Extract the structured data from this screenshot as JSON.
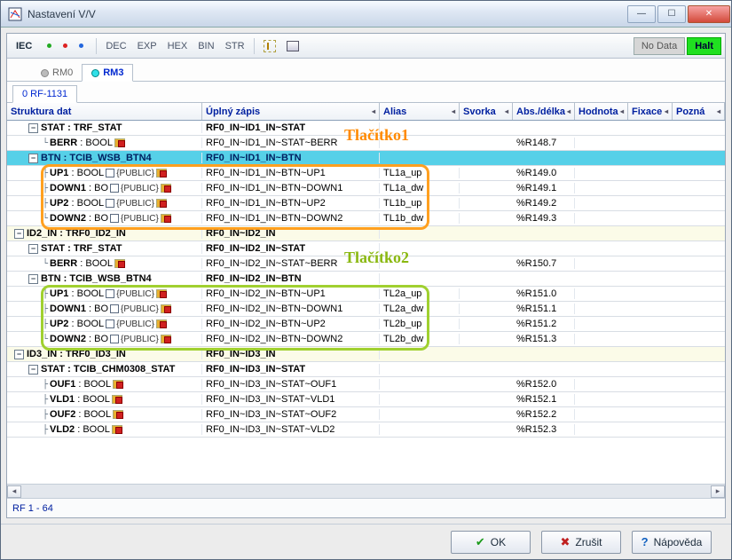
{
  "window": {
    "title": "Nastavení V/V"
  },
  "toolbar": {
    "iec": "IEC",
    "fmt": [
      "DEC",
      "EXP",
      "HEX",
      "BIN",
      "STR"
    ],
    "nodata": "No Data",
    "halt": "Halt"
  },
  "rmtabs": {
    "rm0": "RM0",
    "rm3": "RM3"
  },
  "nodetab": "0 RF-1131",
  "columns": {
    "struct": "Struktura dat",
    "full": "Úplný zápis",
    "alias": "Alias",
    "svorka": "Svorka",
    "abs": "Abs./délka",
    "hodnota": "Hodnota",
    "fix": "Fixace",
    "pozn": "Pozná"
  },
  "rows": [
    {
      "indent": 1,
      "glyph": "-",
      "name": "STAT",
      "type": ": TRF_STAT",
      "full": "RF0_IN~ID1_IN~STAT",
      "bold": true,
      "icon": false
    },
    {
      "indent": 2,
      "glyph": "L",
      "name": "BERR",
      "type": ": BOOL",
      "full": "RF0_IN~ID1_IN~STAT~BERR",
      "abs": "%R148.7",
      "icon": true
    },
    {
      "indent": 1,
      "glyph": "-",
      "name": "BTN",
      "type": ": TCIB_WSB_BTN4",
      "full": "RF0_IN~ID1_IN~BTN",
      "bold": true,
      "hl": "cyan",
      "icon": false
    },
    {
      "indent": 2,
      "glyph": "T",
      "name": "UP1",
      "type": ": BOOL",
      "pub": true,
      "full": "RF0_IN~ID1_IN~BTN~UP1",
      "alias": "TL1a_up",
      "abs": "%R149.0",
      "icon": true
    },
    {
      "indent": 2,
      "glyph": "T",
      "name": "DOWN1",
      "type": ": BO",
      "pub": true,
      "full": "RF0_IN~ID1_IN~BTN~DOWN1",
      "alias": "TL1a_dw",
      "abs": "%R149.1",
      "icon": true
    },
    {
      "indent": 2,
      "glyph": "T",
      "name": "UP2",
      "type": ": BOOL",
      "pub": true,
      "full": "RF0_IN~ID1_IN~BTN~UP2",
      "alias": "TL1b_up",
      "abs": "%R149.2",
      "icon": true
    },
    {
      "indent": 2,
      "glyph": "L",
      "name": "DOWN2",
      "type": ": BO",
      "pub": true,
      "full": "RF0_IN~ID1_IN~BTN~DOWN2",
      "alias": "TL1b_dw",
      "abs": "%R149.3",
      "icon": true
    },
    {
      "indent": 0,
      "glyph": "-",
      "name": "ID2_IN",
      "type": ": TRF0_ID2_IN",
      "full": "RF0_IN~ID2_IN",
      "bold": true,
      "hl": "pale",
      "icon": false
    },
    {
      "indent": 1,
      "glyph": "-",
      "name": "STAT",
      "type": ": TRF_STAT",
      "full": "RF0_IN~ID2_IN~STAT",
      "bold": true,
      "icon": false
    },
    {
      "indent": 2,
      "glyph": "L",
      "name": "BERR",
      "type": ": BOOL",
      "full": "RF0_IN~ID2_IN~STAT~BERR",
      "abs": "%R150.7",
      "icon": true
    },
    {
      "indent": 1,
      "glyph": "-",
      "name": "BTN",
      "type": ": TCIB_WSB_BTN4",
      "full": "RF0_IN~ID2_IN~BTN",
      "bold": true,
      "icon": false
    },
    {
      "indent": 2,
      "glyph": "T",
      "name": "UP1",
      "type": ": BOOL",
      "pub": true,
      "full": "RF0_IN~ID2_IN~BTN~UP1",
      "alias": "TL2a_up",
      "abs": "%R151.0",
      "icon": true
    },
    {
      "indent": 2,
      "glyph": "T",
      "name": "DOWN1",
      "type": ": BO",
      "pub": true,
      "full": "RF0_IN~ID2_IN~BTN~DOWN1",
      "alias": "TL2a_dw",
      "abs": "%R151.1",
      "icon": true
    },
    {
      "indent": 2,
      "glyph": "T",
      "name": "UP2",
      "type": ": BOOL",
      "pub": true,
      "full": "RF0_IN~ID2_IN~BTN~UP2",
      "alias": "TL2b_up",
      "abs": "%R151.2",
      "icon": true
    },
    {
      "indent": 2,
      "glyph": "L",
      "name": "DOWN2",
      "type": ": BO",
      "pub": true,
      "full": "RF0_IN~ID2_IN~BTN~DOWN2",
      "alias": "TL2b_dw",
      "abs": "%R151.3",
      "icon": true
    },
    {
      "indent": 0,
      "glyph": "-",
      "name": "ID3_IN",
      "type": ": TRF0_ID3_IN",
      "full": "RF0_IN~ID3_IN",
      "bold": true,
      "hl": "pale",
      "icon": false
    },
    {
      "indent": 1,
      "glyph": "-",
      "name": "STAT",
      "type": ": TCIB_CHM0308_STAT",
      "full": "RF0_IN~ID3_IN~STAT",
      "bold": true,
      "icon": false
    },
    {
      "indent": 2,
      "glyph": "T",
      "name": "OUF1",
      "type": ": BOOL",
      "full": "RF0_IN~ID3_IN~STAT~OUF1",
      "abs": "%R152.0",
      "icon": true
    },
    {
      "indent": 2,
      "glyph": "T",
      "name": "VLD1",
      "type": ": BOOL",
      "full": "RF0_IN~ID3_IN~STAT~VLD1",
      "abs": "%R152.1",
      "icon": true
    },
    {
      "indent": 2,
      "glyph": "T",
      "name": "OUF2",
      "type": ": BOOL",
      "full": "RF0_IN~ID3_IN~STAT~OUF2",
      "abs": "%R152.2",
      "icon": true
    },
    {
      "indent": 2,
      "glyph": "T",
      "name": "VLD2",
      "type": ": BOOL",
      "full": "RF0_IN~ID3_IN~STAT~VLD2",
      "abs": "%R152.3",
      "icon": true
    }
  ],
  "annotations": {
    "lbl1": "Tlačítko1",
    "lbl2": "Tlačítko2"
  },
  "status": "RF 1 - 64",
  "buttons": {
    "ok": "OK",
    "cancel": "Zrušit",
    "help": "Nápověda"
  }
}
